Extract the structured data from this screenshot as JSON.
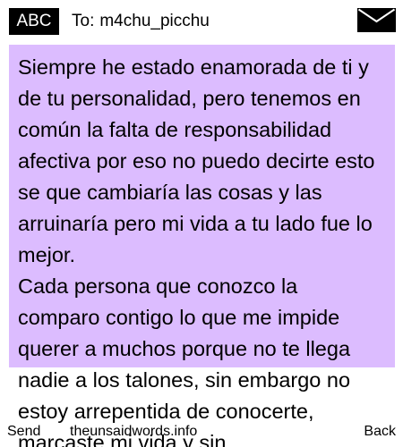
{
  "header": {
    "mode_label": "ABC",
    "to_label": "To:",
    "recipient": "m4chu_picchu",
    "mail_icon": "envelope-icon"
  },
  "message": {
    "paragraphs": [
      "Siempre he estado enamorada de ti y de tu personalidad, pero tenemos en común la falta de responsabilidad afectiva por eso no puedo decirte esto se que cambiaría las cosas y las arruinaría pero mi vida a tu lado fue lo mejor.",
      "Cada persona que conozco la comparo contigo lo que me impide querer a muchos porque no te llega nadie a los talones, sin embargo no estoy arrepentida de conocerte, marcaste mi vida y sin"
    ],
    "panel_color": "#dcbcff"
  },
  "footer": {
    "left_softkey": "Send",
    "center_text": "theunsaidwords.info",
    "right_softkey": "Back"
  }
}
